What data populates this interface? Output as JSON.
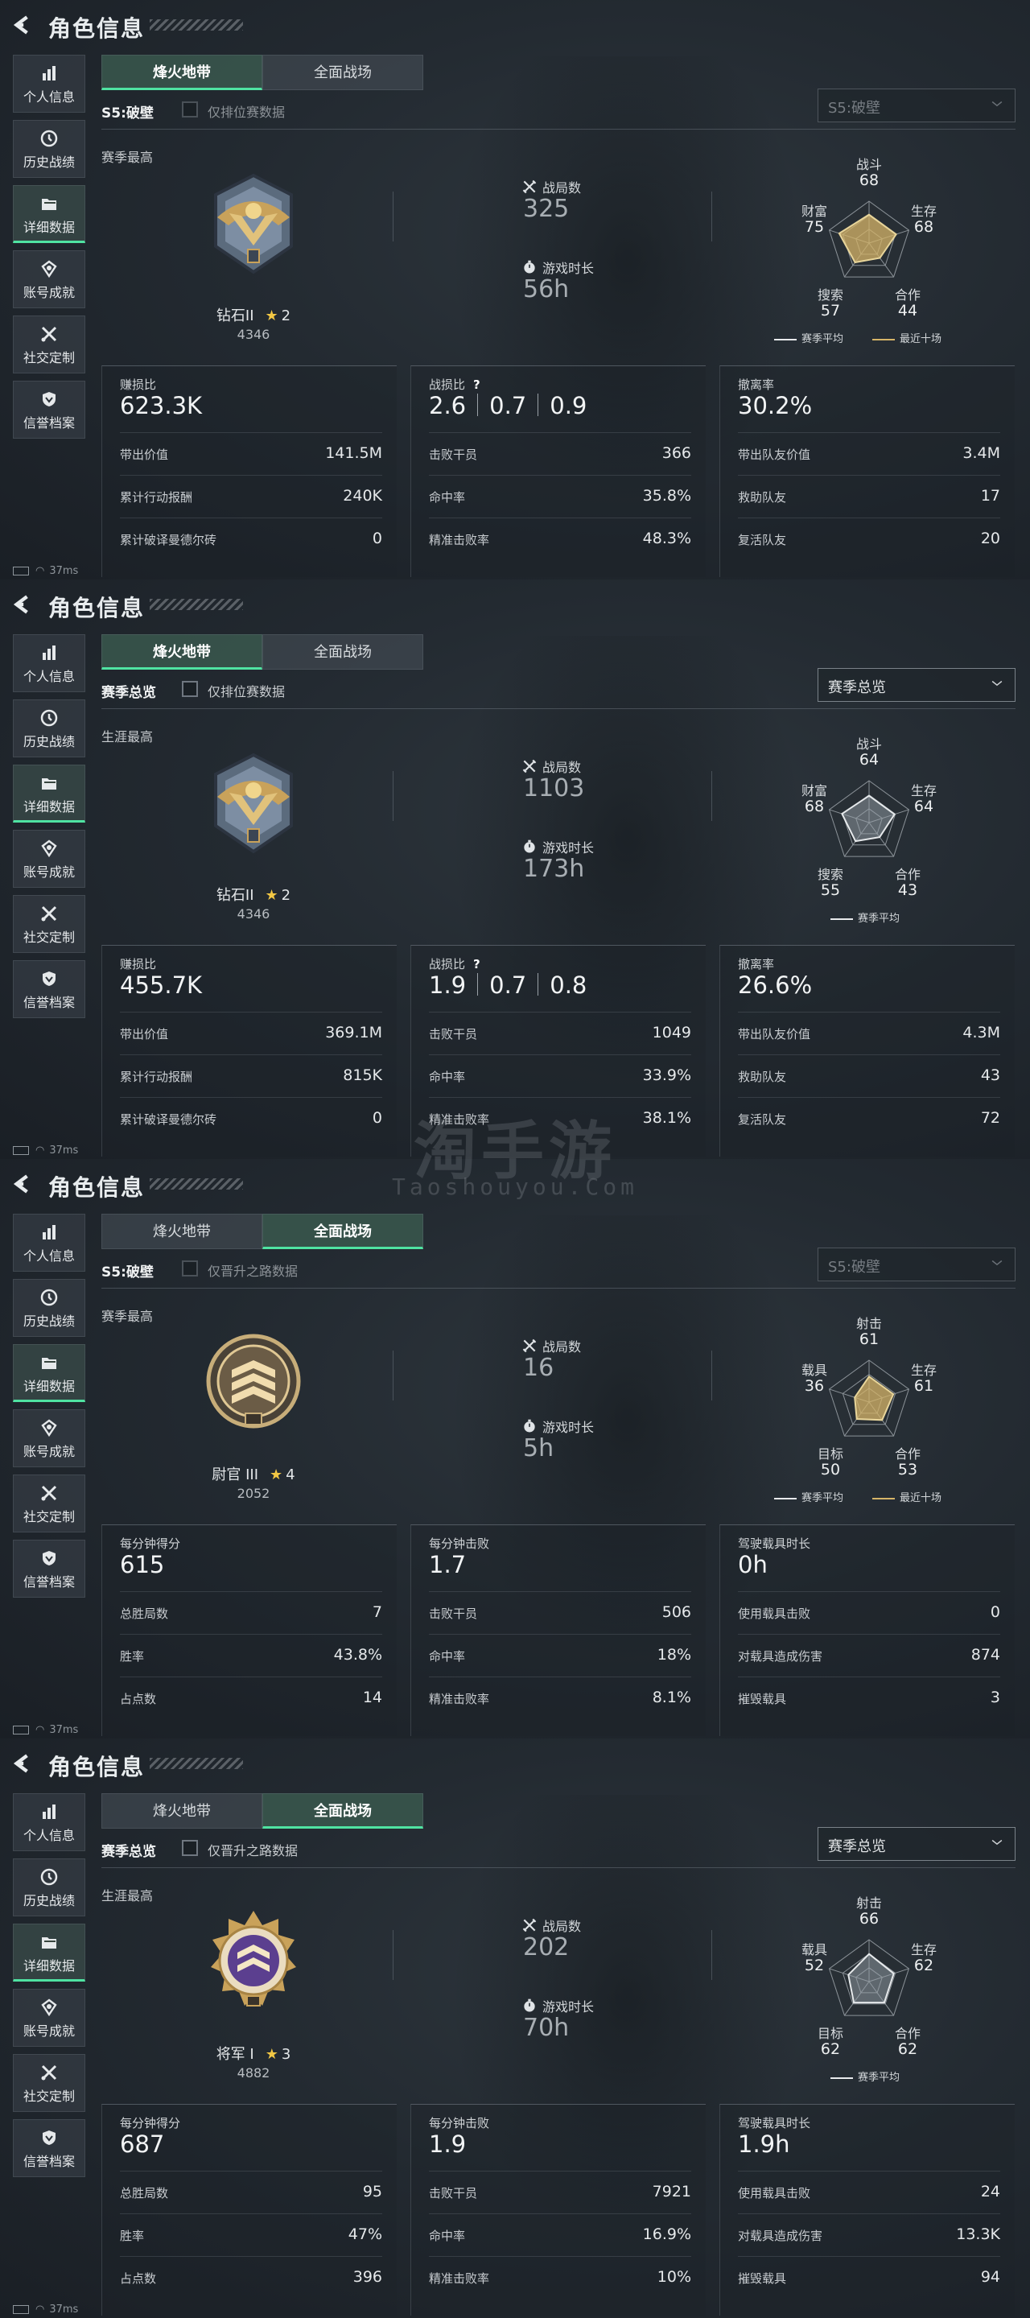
{
  "app": {
    "title": "角色信息"
  },
  "sidebar": {
    "items": [
      {
        "label": "个人信息",
        "icon": "bar-chart-icon"
      },
      {
        "label": "历史战绩",
        "icon": "clock-icon"
      },
      {
        "label": "详细数据",
        "icon": "folder-icon"
      },
      {
        "label": "账号成就",
        "icon": "medal-icon"
      },
      {
        "label": "社交定制",
        "icon": "tools-icon"
      },
      {
        "label": "信誉档案",
        "icon": "shield-icon"
      }
    ]
  },
  "tabs": [
    "烽火地带",
    "全面战场"
  ],
  "status_ping": "37ms",
  "watermark": {
    "main": "淘手游",
    "sub": "Taoshouyou.Com"
  },
  "screens": [
    {
      "active_tab": 0,
      "season_label": "S5:破壁",
      "checkbox_label": "仅排位赛数据",
      "dropdown": "S5:破壁",
      "best_label": "赛季最高",
      "rank_name": "钻石II",
      "rank_stars": "2",
      "rank_score": "4346",
      "matches_label": "战局数",
      "matches": "325",
      "time_label": "游戏时长",
      "time": "56h",
      "radar": {
        "labels": [
          "战斗",
          "生存",
          "合作",
          "搜索",
          "财富"
        ],
        "values": [
          68,
          68,
          44,
          57,
          75
        ],
        "shape": "gold"
      },
      "legend": {
        "avg": "赛季平均",
        "recent": "最近十场"
      },
      "panels": [
        {
          "label": "赚损比",
          "big": "623.3K",
          "rows": [
            [
              "带出价值",
              "141.5M"
            ],
            [
              "累计行动报酬",
              "240K"
            ],
            [
              "累计破译曼德尔砖",
              "0"
            ]
          ]
        },
        {
          "label": "战损比",
          "multi": [
            "2.6",
            "0.7",
            "0.9"
          ],
          "rows": [
            [
              "击败干员",
              "366"
            ],
            [
              "命中率",
              "35.8%"
            ],
            [
              "精准击败率",
              "48.3%"
            ]
          ]
        },
        {
          "label": "撤离率",
          "big": "30.2%",
          "rows": [
            [
              "带出队友价值",
              "3.4M"
            ],
            [
              "救助队友",
              "17"
            ],
            [
              "复活队友",
              "20"
            ]
          ]
        }
      ]
    },
    {
      "active_tab": 0,
      "season_label": "赛季总览",
      "checkbox_label": "仅排位赛数据",
      "dropdown": "赛季总览",
      "best_label": "生涯最高",
      "rank_name": "钻石II",
      "rank_stars": "2",
      "rank_score": "4346",
      "matches_label": "战局数",
      "matches": "1103",
      "time_label": "游戏时长",
      "time": "173h",
      "radar": {
        "labels": [
          "战斗",
          "生存",
          "合作",
          "搜索",
          "财富"
        ],
        "values": [
          64,
          64,
          43,
          55,
          68
        ],
        "shape": "grey"
      },
      "legend": {
        "avg": "赛季平均",
        "recent": ""
      },
      "panels": [
        {
          "label": "赚损比",
          "big": "455.7K",
          "rows": [
            [
              "带出价值",
              "369.1M"
            ],
            [
              "累计行动报酬",
              "815K"
            ],
            [
              "累计破译曼德尔砖",
              "0"
            ]
          ]
        },
        {
          "label": "战损比",
          "multi": [
            "1.9",
            "0.7",
            "0.8"
          ],
          "rows": [
            [
              "击败干员",
              "1049"
            ],
            [
              "命中率",
              "33.9%"
            ],
            [
              "精准击败率",
              "38.1%"
            ]
          ]
        },
        {
          "label": "撤离率",
          "big": "26.6%",
          "rows": [
            [
              "带出队友价值",
              "4.3M"
            ],
            [
              "救助队友",
              "43"
            ],
            [
              "复活队友",
              "72"
            ]
          ]
        }
      ]
    },
    {
      "active_tab": 1,
      "season_label": "S5:破壁",
      "checkbox_label": "仅晋升之路数据",
      "dropdown": "S5:破壁",
      "best_label": "赛季最高",
      "rank_name": "尉官 III",
      "rank_stars": "4",
      "rank_score": "2052",
      "matches_label": "战局数",
      "matches": "16",
      "time_label": "游戏时长",
      "time": "5h",
      "radar": {
        "labels": [
          "射击",
          "生存",
          "合作",
          "目标",
          "载具"
        ],
        "values": [
          61,
          61,
          53,
          50,
          36
        ],
        "shape": "gold"
      },
      "legend": {
        "avg": "赛季平均",
        "recent": "最近十场"
      },
      "panels": [
        {
          "label": "每分钟得分",
          "big": "615",
          "rows": [
            [
              "总胜局数",
              "7"
            ],
            [
              "胜率",
              "43.8%"
            ],
            [
              "占点数",
              "14"
            ]
          ]
        },
        {
          "label": "每分钟击败",
          "big": "1.7",
          "rows": [
            [
              "击败干员",
              "506"
            ],
            [
              "命中率",
              "18%"
            ],
            [
              "精准击败率",
              "8.1%"
            ]
          ]
        },
        {
          "label": "驾驶载具时长",
          "big": "0h",
          "rows": [
            [
              "使用载具击败",
              "0"
            ],
            [
              "对载具造成伤害",
              "874"
            ],
            [
              "摧毁载具",
              "3"
            ]
          ]
        }
      ]
    },
    {
      "active_tab": 1,
      "season_label": "赛季总览",
      "checkbox_label": "仅晋升之路数据",
      "dropdown": "赛季总览",
      "best_label": "生涯最高",
      "rank_name": "将军 I",
      "rank_stars": "3",
      "rank_score": "4882",
      "matches_label": "战局数",
      "matches": "202",
      "time_label": "游戏时长",
      "time": "70h",
      "radar": {
        "labels": [
          "射击",
          "生存",
          "合作",
          "目标",
          "载具"
        ],
        "values": [
          66,
          62,
          62,
          62,
          52
        ],
        "shape": "grey"
      },
      "legend": {
        "avg": "赛季平均",
        "recent": ""
      },
      "panels": [
        {
          "label": "每分钟得分",
          "big": "687",
          "rows": [
            [
              "总胜局数",
              "95"
            ],
            [
              "胜率",
              "47%"
            ],
            [
              "占点数",
              "396"
            ]
          ]
        },
        {
          "label": "每分钟击败",
          "big": "1.9",
          "rows": [
            [
              "击败干员",
              "7921"
            ],
            [
              "命中率",
              "16.9%"
            ],
            [
              "精准击败率",
              "10%"
            ]
          ]
        },
        {
          "label": "驾驶载具时长",
          "big": "1.9h",
          "rows": [
            [
              "使用载具击败",
              "24"
            ],
            [
              "对载具造成伤害",
              "13.3K"
            ],
            [
              "摧毁载具",
              "94"
            ]
          ]
        }
      ]
    }
  ],
  "colors": {
    "accent": "#4fe3a2",
    "gold": "#d6b468",
    "star": "#f2c744",
    "bg": "#232a31"
  }
}
